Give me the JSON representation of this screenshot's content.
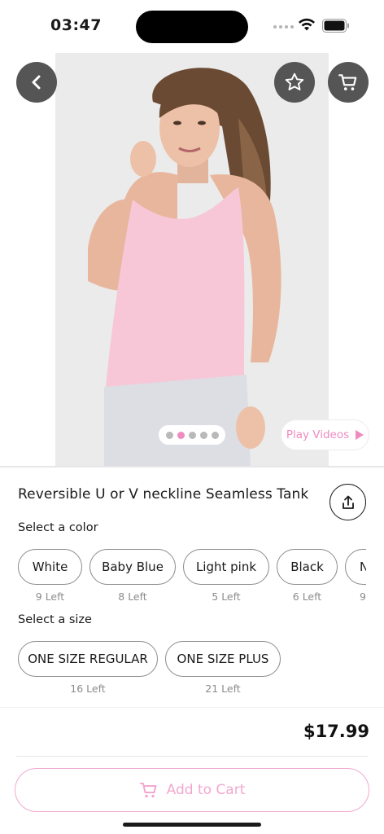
{
  "status_bar": {
    "time": "03:47"
  },
  "product": {
    "title": "Reversible U or V neckline Seamless Tank",
    "price": "$17.99"
  },
  "media": {
    "play_videos_label": "Play Videos",
    "image_count": 5,
    "active_index": 1
  },
  "colors": {
    "label": "Select a color",
    "options": [
      {
        "name": "White",
        "stock": "9 Left"
      },
      {
        "name": "Baby Blue",
        "stock": "8 Left"
      },
      {
        "name": "Light pink",
        "stock": "5 Left"
      },
      {
        "name": "Black",
        "stock": "6 Left"
      },
      {
        "name": "N",
        "stock": "9"
      }
    ]
  },
  "sizes": {
    "label": "Select a size",
    "options": [
      {
        "name": "ONE SIZE REGULAR",
        "stock": "16 Left"
      },
      {
        "name": "ONE SIZE PLUS",
        "stock": "21 Left"
      }
    ]
  },
  "actions": {
    "add_to_cart_label": "Add to Cart"
  },
  "theme": {
    "accent": "#f08bc0",
    "accent_light": "#f2a8cf",
    "tank_color": "#f7c7d8"
  },
  "icons": [
    "back-icon",
    "star-icon",
    "cart-icon",
    "share-icon",
    "play-icon",
    "wifi-icon",
    "battery-icon"
  ]
}
